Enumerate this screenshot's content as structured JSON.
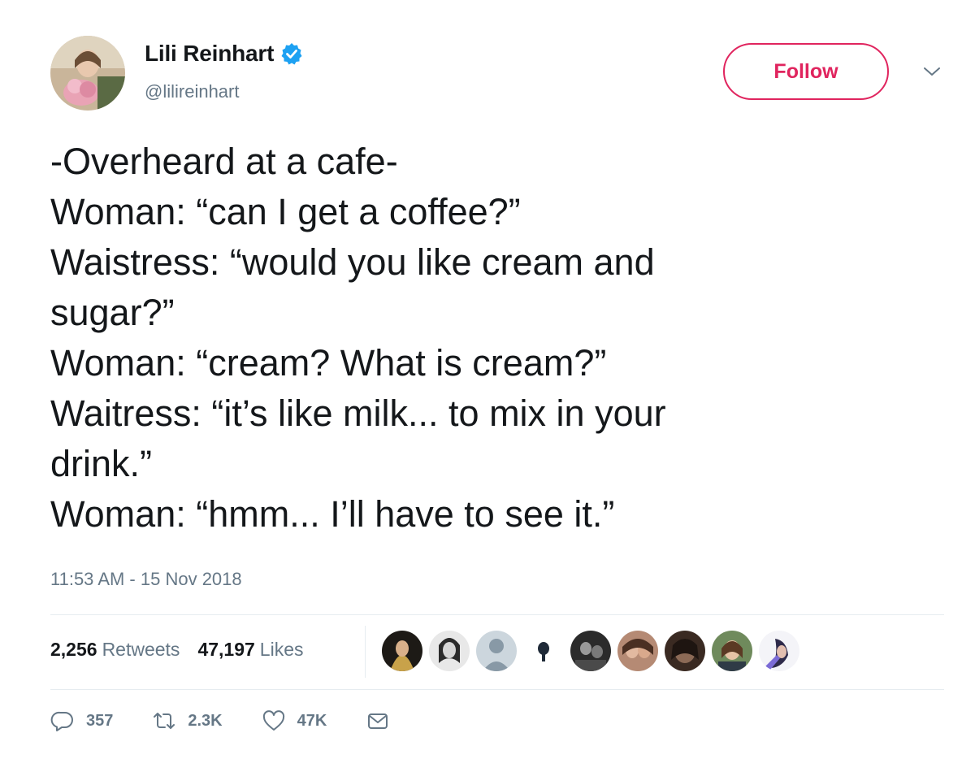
{
  "author": {
    "name": "Lili Reinhart",
    "handle": "@lilireinhart",
    "verified": true
  },
  "follow_button": {
    "label": "Follow"
  },
  "tweet": {
    "lines": [
      "-Overheard at a cafe-",
      "Woman: “can I get a coffee?”",
      "Waistress: “would you like cream and",
      "sugar?”",
      "Woman: “cream? What is cream?”",
      "Waitress: “it’s like milk... to mix in your",
      "drink.”",
      "Woman: “hmm... I’ll have to see it.”"
    ],
    "timestamp": "11:53 AM - 15 Nov 2018"
  },
  "stats": {
    "retweets_count": "2,256",
    "retweets_label": "Retweets",
    "likes_count": "47,197",
    "likes_label": "Likes"
  },
  "actions": {
    "reply_count": "357",
    "retweet_count": "2.3K",
    "like_count": "47K"
  },
  "icons": [
    "verified-badge-icon",
    "chevron-down-icon",
    "reply-icon",
    "retweet-icon",
    "like-icon",
    "message-icon"
  ],
  "colors": {
    "follow_accent": "#e0245e",
    "verified_blue": "#1da1f2",
    "secondary_text": "#657786",
    "primary_text": "#14171a",
    "divider": "#e6ecf0"
  }
}
